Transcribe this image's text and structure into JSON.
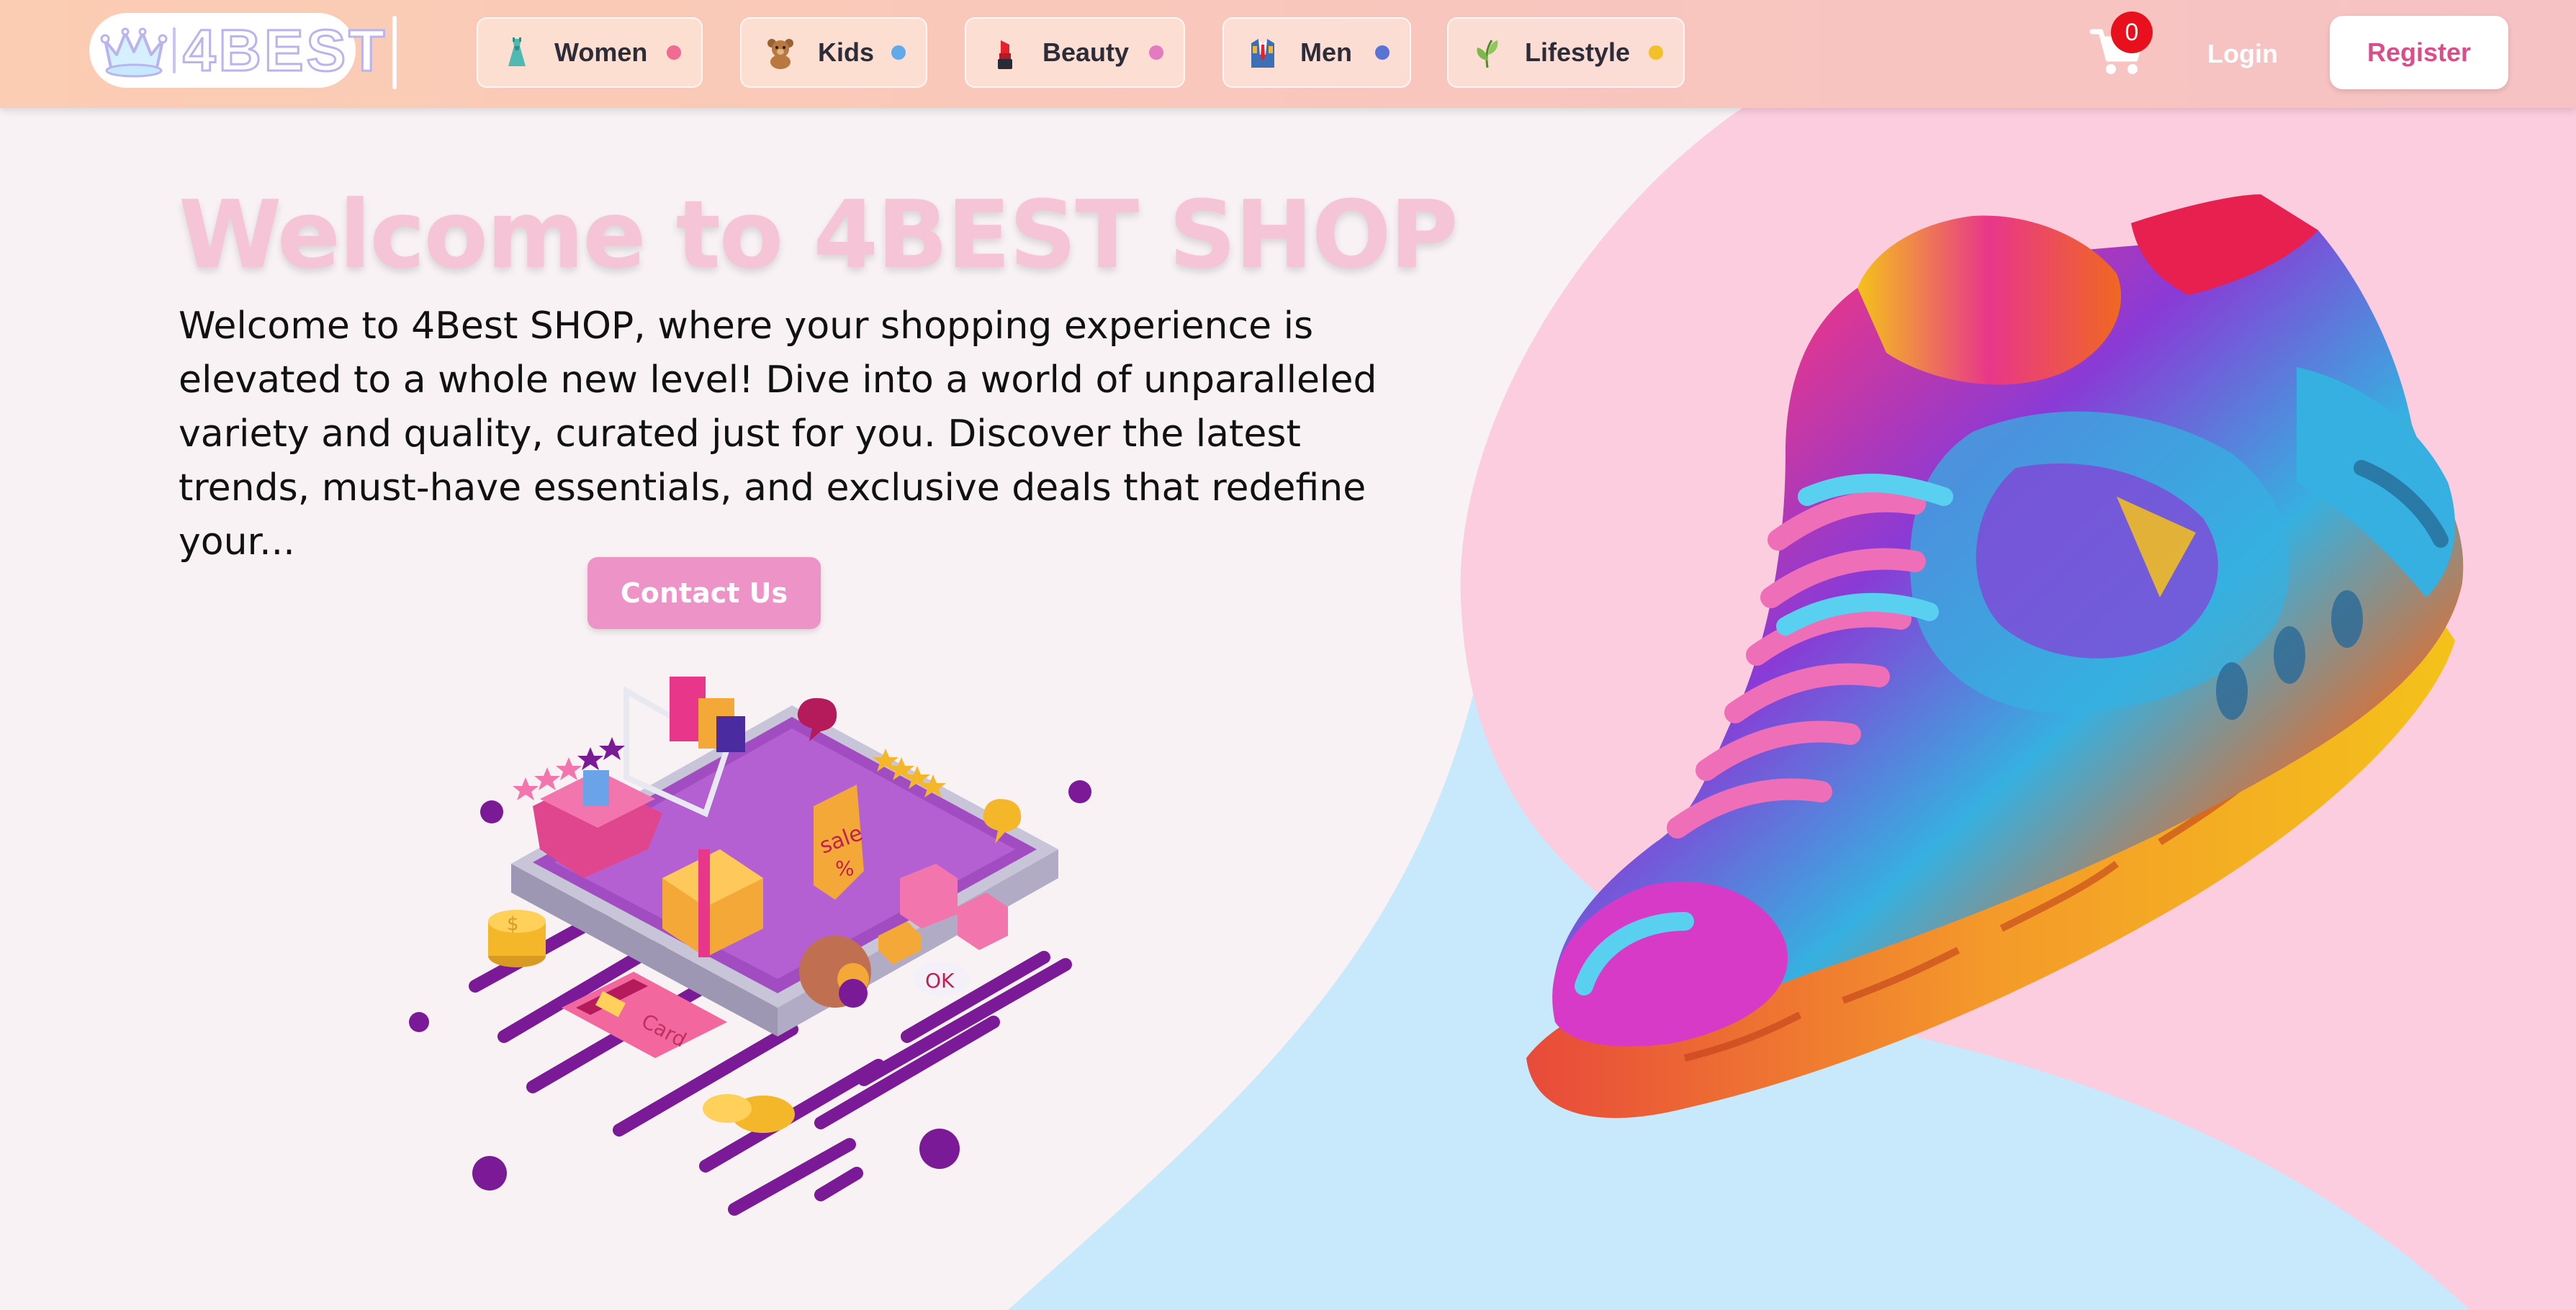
{
  "brand": {
    "logo_text": "4BEST"
  },
  "nav": {
    "categories": [
      {
        "label": "Women",
        "icon": "dress-icon",
        "dot_color": "#f06a92"
      },
      {
        "label": "Kids",
        "icon": "teddy-bear-icon",
        "dot_color": "#61a9e8"
      },
      {
        "label": "Beauty",
        "icon": "lipstick-icon",
        "dot_color": "#e27bc0"
      },
      {
        "label": "Men",
        "icon": "suit-icon",
        "dot_color": "#5a74d6"
      },
      {
        "label": "Lifestyle",
        "icon": "leaf-icon",
        "dot_color": "#f2c029"
      }
    ],
    "cart_count": "0",
    "login_label": "Login",
    "register_label": "Register"
  },
  "hero": {
    "title": "Welcome to 4BEST SHOP",
    "description": "Welcome to 4Best SHOP, where your shopping experience is elevated to a whole new level! Dive into a world of unparalleled variety and quality, curated just for you. Discover the latest trends, must-have essentials, and exclusive deals that redefine your...",
    "cta_label": "Contact Us",
    "illustration_texts": {
      "sale_tag": "sale",
      "percent": "%",
      "ok_badge": "OK",
      "card": "Card",
      "coin": "$"
    }
  },
  "colors": {
    "title_pink": "#f5c4d6",
    "cta_pink": "#ee93c7",
    "register_text": "#d94d8b",
    "bg_pink": "#fccddf",
    "bg_blue": "#c8e9fb",
    "badge_red": "#e8101c"
  }
}
